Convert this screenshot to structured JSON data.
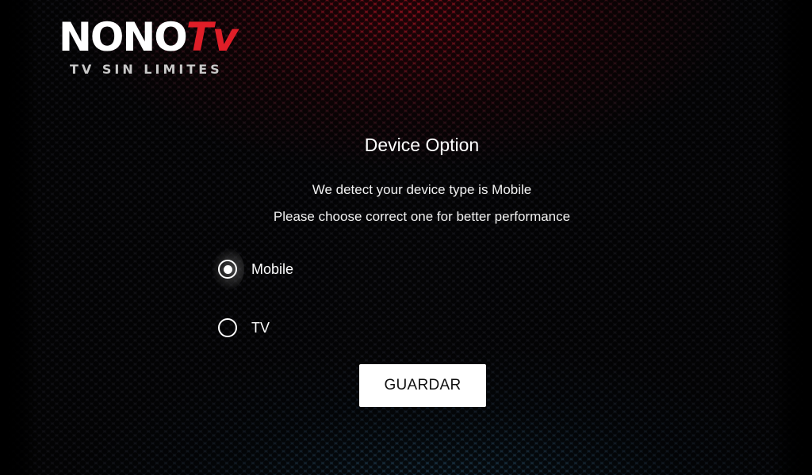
{
  "logo": {
    "name_main": "NONO",
    "name_accent": "Tv",
    "tagline": "TV SIN LIMITES",
    "accent_color": "#e01e28"
  },
  "dialog": {
    "title": "Device Option",
    "message_line1": "We detect your device type is Mobile",
    "message_line2": "Please choose correct one for better performance",
    "options": [
      {
        "label": "Mobile",
        "selected": true,
        "focused": true
      },
      {
        "label": "TV",
        "selected": false,
        "focused": false
      }
    ],
    "save_label": "GUARDAR"
  },
  "icons": {
    "selected_radio": "radio-selected-icon",
    "unselected_radio": "radio-unselected-icon"
  }
}
